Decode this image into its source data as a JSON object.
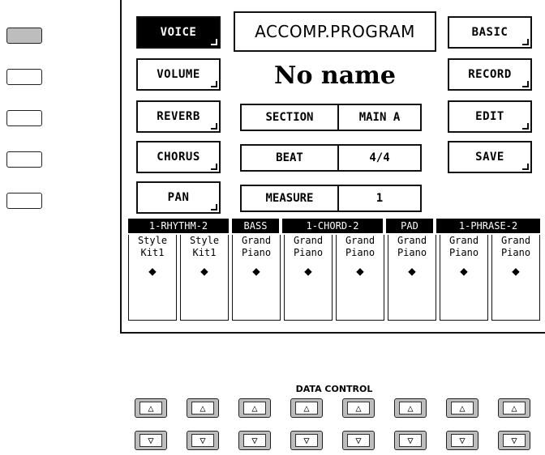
{
  "side_buttons": {
    "count": 5,
    "active_index": 0
  },
  "buttons": {
    "voice": "VOICE",
    "volume": "VOLUME",
    "reverb": "REVERB",
    "chorus": "CHORUS",
    "pan": "PAN",
    "basic": "BASIC",
    "record": "RECORD",
    "edit": "EDIT",
    "save": "SAVE"
  },
  "title": "ACCOMP.PROGRAM",
  "program_name": "No name",
  "section": {
    "label": "SECTION",
    "value": "MAIN A"
  },
  "beat": {
    "label": "BEAT",
    "value": "4/4"
  },
  "measure": {
    "label": "MEASURE",
    "value": "1"
  },
  "track_groups": [
    "1-RHYTHM-2",
    "BASS",
    "1-CHORD-2",
    "PAD",
    "1-PHRASE-2"
  ],
  "voices": [
    {
      "line1": "Style",
      "line2": "Kit1"
    },
    {
      "line1": "Style",
      "line2": "Kit1"
    },
    {
      "line1": "Grand",
      "line2": "Piano"
    },
    {
      "line1": "Grand",
      "line2": "Piano"
    },
    {
      "line1": "Grand",
      "line2": "Piano"
    },
    {
      "line1": "Grand",
      "line2": "Piano"
    },
    {
      "line1": "Grand",
      "line2": "Piano"
    },
    {
      "line1": "Grand",
      "line2": "Piano"
    }
  ],
  "arrow_glyph": "◆",
  "data_control": {
    "label": "DATA CONTROL",
    "up": "△",
    "down": "▽"
  }
}
